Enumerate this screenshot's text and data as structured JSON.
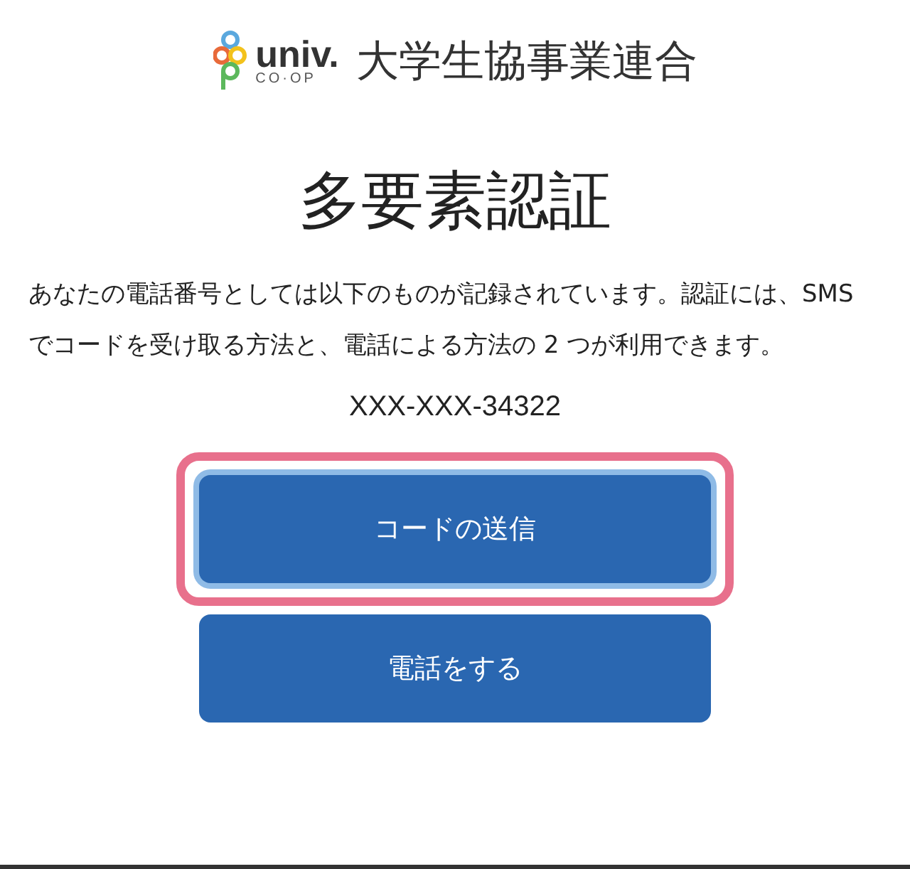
{
  "logo": {
    "wordmark": "univ.",
    "sub": "CO·OP",
    "org_name": "大学生協事業連合"
  },
  "title": "多要素認証",
  "description": "あなたの電話番号としては以下のものが記録されています。認証には、SMS でコードを受け取る方法と、電話による方法の 2 つが利用できます。",
  "phone": "XXX-XXX-34322",
  "buttons": [
    {
      "label": "コードの送信",
      "focused": true,
      "highlighted": true
    },
    {
      "label": "電話をする",
      "focused": false,
      "highlighted": false
    }
  ]
}
